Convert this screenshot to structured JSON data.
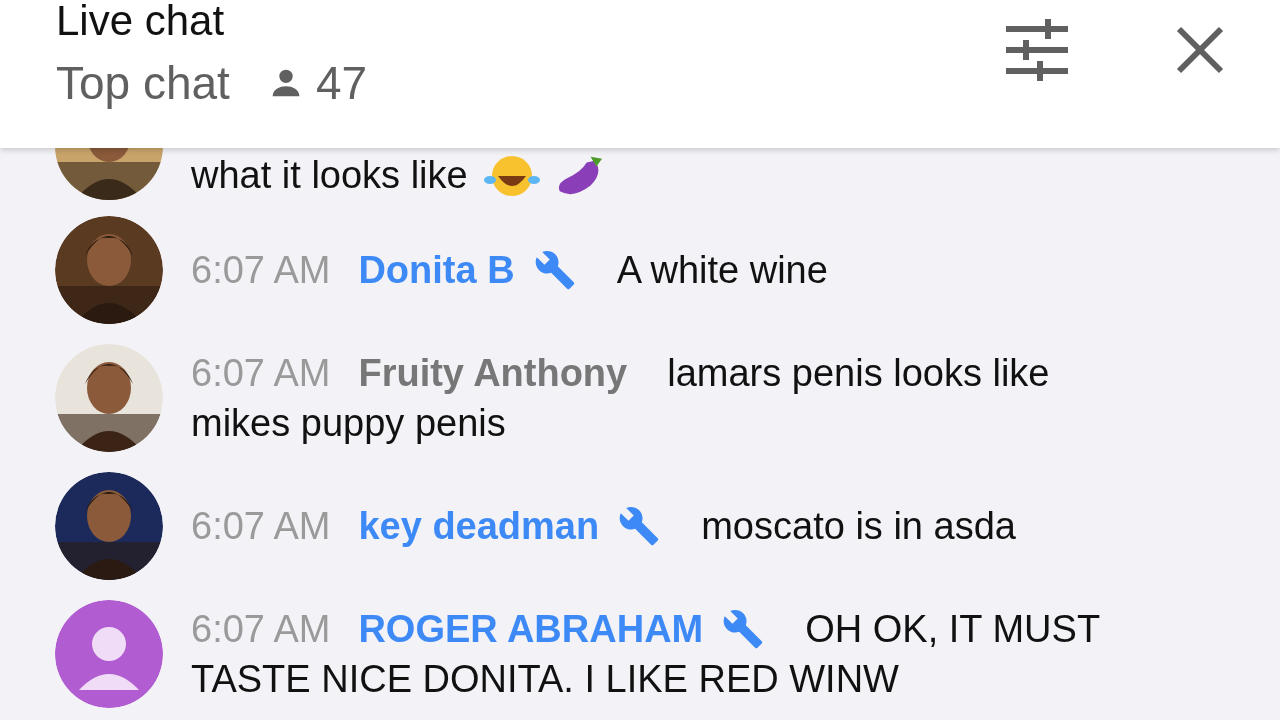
{
  "header": {
    "title": "Live chat",
    "mode": "Top chat",
    "viewers": "47"
  },
  "messages": [
    {
      "kind": "emoji_tail",
      "text": "what it looks like"
    },
    {
      "kind": "full",
      "time": "6:07 AM",
      "author": "Donita B",
      "moderator": true,
      "text": "A white wine"
    },
    {
      "kind": "full",
      "time": "6:07 AM",
      "author": "Fruity Anthony",
      "moderator": false,
      "text": "lamars penis looks like mikes puppy penis"
    },
    {
      "kind": "full",
      "time": "6:07 AM",
      "author": "key deadman",
      "moderator": true,
      "text": "moscato is in asda"
    },
    {
      "kind": "full",
      "avatar": {
        "kind": "default"
      },
      "time": "6:07 AM",
      "author": "ROGER ABRAHAM",
      "moderator": true,
      "text": "OH OK, IT MUST TASTE NICE DONITA. I LIKE RED WINW"
    }
  ]
}
